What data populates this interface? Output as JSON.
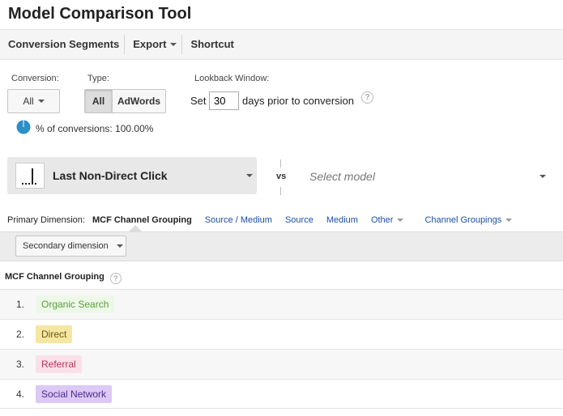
{
  "title": "Model Comparison Tool",
  "toolbar": {
    "conversion_segments": "Conversion Segments",
    "export": "Export",
    "shortcut": "Shortcut"
  },
  "filters": {
    "conversion_label": "Conversion:",
    "conversion_value": "All",
    "type_label": "Type:",
    "type_options": [
      "All",
      "AdWords"
    ],
    "type_selected": "All",
    "lookback_label": "Lookback Window:",
    "set_label": "Set",
    "days_value": "30",
    "days_suffix": "days prior to conversion"
  },
  "conversions_pct": {
    "label": "% of conversions: 100.00%",
    "value_percent": 100
  },
  "models": {
    "primary": "Last Non-Direct Click",
    "vs": "vs",
    "select_placeholder": "Select model"
  },
  "dimensions": {
    "primary_label": "Primary Dimension:",
    "active": "MCF Channel Grouping",
    "links": [
      "Source / Medium",
      "Source",
      "Medium"
    ],
    "other": "Other",
    "channel_groupings": "Channel Groupings",
    "secondary": "Secondary dimension"
  },
  "table": {
    "header": "MCF Channel Grouping",
    "rows": [
      {
        "num": "1.",
        "label": "Organic Search",
        "color": "#55a036",
        "bg": "#eef8e9"
      },
      {
        "num": "2.",
        "label": "Direct",
        "color": "#6b5a14",
        "bg": "#f5e6a2"
      },
      {
        "num": "3.",
        "label": "Referral",
        "color": "#b0385a",
        "bg": "#fbe0ea"
      },
      {
        "num": "4.",
        "label": "Social Network",
        "color": "#4a2a8a",
        "bg": "#dcc9f5"
      }
    ]
  },
  "colors": {
    "link": "#1a4fa8",
    "pie": "#2c8fc6"
  }
}
